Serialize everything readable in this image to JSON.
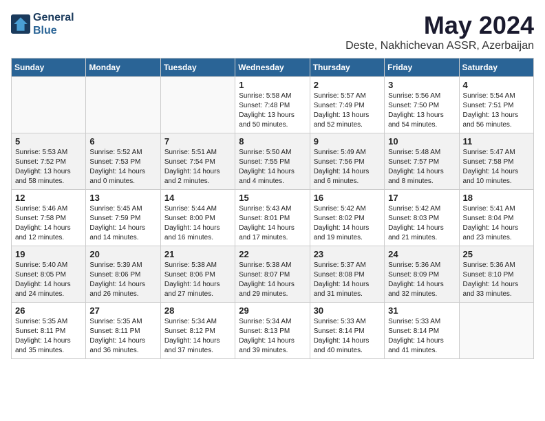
{
  "header": {
    "logo_line1": "General",
    "logo_line2": "Blue",
    "title": "May 2024",
    "subtitle": "Deste, Nakhichevan ASSR, Azerbaijan"
  },
  "columns": [
    "Sunday",
    "Monday",
    "Tuesday",
    "Wednesday",
    "Thursday",
    "Friday",
    "Saturday"
  ],
  "weeks": [
    [
      {
        "day": "",
        "info": ""
      },
      {
        "day": "",
        "info": ""
      },
      {
        "day": "",
        "info": ""
      },
      {
        "day": "1",
        "info": "Sunrise: 5:58 AM\nSunset: 7:48 PM\nDaylight: 13 hours\nand 50 minutes."
      },
      {
        "day": "2",
        "info": "Sunrise: 5:57 AM\nSunset: 7:49 PM\nDaylight: 13 hours\nand 52 minutes."
      },
      {
        "day": "3",
        "info": "Sunrise: 5:56 AM\nSunset: 7:50 PM\nDaylight: 13 hours\nand 54 minutes."
      },
      {
        "day": "4",
        "info": "Sunrise: 5:54 AM\nSunset: 7:51 PM\nDaylight: 13 hours\nand 56 minutes."
      }
    ],
    [
      {
        "day": "5",
        "info": "Sunrise: 5:53 AM\nSunset: 7:52 PM\nDaylight: 13 hours\nand 58 minutes."
      },
      {
        "day": "6",
        "info": "Sunrise: 5:52 AM\nSunset: 7:53 PM\nDaylight: 14 hours\nand 0 minutes."
      },
      {
        "day": "7",
        "info": "Sunrise: 5:51 AM\nSunset: 7:54 PM\nDaylight: 14 hours\nand 2 minutes."
      },
      {
        "day": "8",
        "info": "Sunrise: 5:50 AM\nSunset: 7:55 PM\nDaylight: 14 hours\nand 4 minutes."
      },
      {
        "day": "9",
        "info": "Sunrise: 5:49 AM\nSunset: 7:56 PM\nDaylight: 14 hours\nand 6 minutes."
      },
      {
        "day": "10",
        "info": "Sunrise: 5:48 AM\nSunset: 7:57 PM\nDaylight: 14 hours\nand 8 minutes."
      },
      {
        "day": "11",
        "info": "Sunrise: 5:47 AM\nSunset: 7:58 PM\nDaylight: 14 hours\nand 10 minutes."
      }
    ],
    [
      {
        "day": "12",
        "info": "Sunrise: 5:46 AM\nSunset: 7:58 PM\nDaylight: 14 hours\nand 12 minutes."
      },
      {
        "day": "13",
        "info": "Sunrise: 5:45 AM\nSunset: 7:59 PM\nDaylight: 14 hours\nand 14 minutes."
      },
      {
        "day": "14",
        "info": "Sunrise: 5:44 AM\nSunset: 8:00 PM\nDaylight: 14 hours\nand 16 minutes."
      },
      {
        "day": "15",
        "info": "Sunrise: 5:43 AM\nSunset: 8:01 PM\nDaylight: 14 hours\nand 17 minutes."
      },
      {
        "day": "16",
        "info": "Sunrise: 5:42 AM\nSunset: 8:02 PM\nDaylight: 14 hours\nand 19 minutes."
      },
      {
        "day": "17",
        "info": "Sunrise: 5:42 AM\nSunset: 8:03 PM\nDaylight: 14 hours\nand 21 minutes."
      },
      {
        "day": "18",
        "info": "Sunrise: 5:41 AM\nSunset: 8:04 PM\nDaylight: 14 hours\nand 23 minutes."
      }
    ],
    [
      {
        "day": "19",
        "info": "Sunrise: 5:40 AM\nSunset: 8:05 PM\nDaylight: 14 hours\nand 24 minutes."
      },
      {
        "day": "20",
        "info": "Sunrise: 5:39 AM\nSunset: 8:06 PM\nDaylight: 14 hours\nand 26 minutes."
      },
      {
        "day": "21",
        "info": "Sunrise: 5:38 AM\nSunset: 8:06 PM\nDaylight: 14 hours\nand 27 minutes."
      },
      {
        "day": "22",
        "info": "Sunrise: 5:38 AM\nSunset: 8:07 PM\nDaylight: 14 hours\nand 29 minutes."
      },
      {
        "day": "23",
        "info": "Sunrise: 5:37 AM\nSunset: 8:08 PM\nDaylight: 14 hours\nand 31 minutes."
      },
      {
        "day": "24",
        "info": "Sunrise: 5:36 AM\nSunset: 8:09 PM\nDaylight: 14 hours\nand 32 minutes."
      },
      {
        "day": "25",
        "info": "Sunrise: 5:36 AM\nSunset: 8:10 PM\nDaylight: 14 hours\nand 33 minutes."
      }
    ],
    [
      {
        "day": "26",
        "info": "Sunrise: 5:35 AM\nSunset: 8:11 PM\nDaylight: 14 hours\nand 35 minutes."
      },
      {
        "day": "27",
        "info": "Sunrise: 5:35 AM\nSunset: 8:11 PM\nDaylight: 14 hours\nand 36 minutes."
      },
      {
        "day": "28",
        "info": "Sunrise: 5:34 AM\nSunset: 8:12 PM\nDaylight: 14 hours\nand 37 minutes."
      },
      {
        "day": "29",
        "info": "Sunrise: 5:34 AM\nSunset: 8:13 PM\nDaylight: 14 hours\nand 39 minutes."
      },
      {
        "day": "30",
        "info": "Sunrise: 5:33 AM\nSunset: 8:14 PM\nDaylight: 14 hours\nand 40 minutes."
      },
      {
        "day": "31",
        "info": "Sunrise: 5:33 AM\nSunset: 8:14 PM\nDaylight: 14 hours\nand 41 minutes."
      },
      {
        "day": "",
        "info": ""
      }
    ]
  ]
}
